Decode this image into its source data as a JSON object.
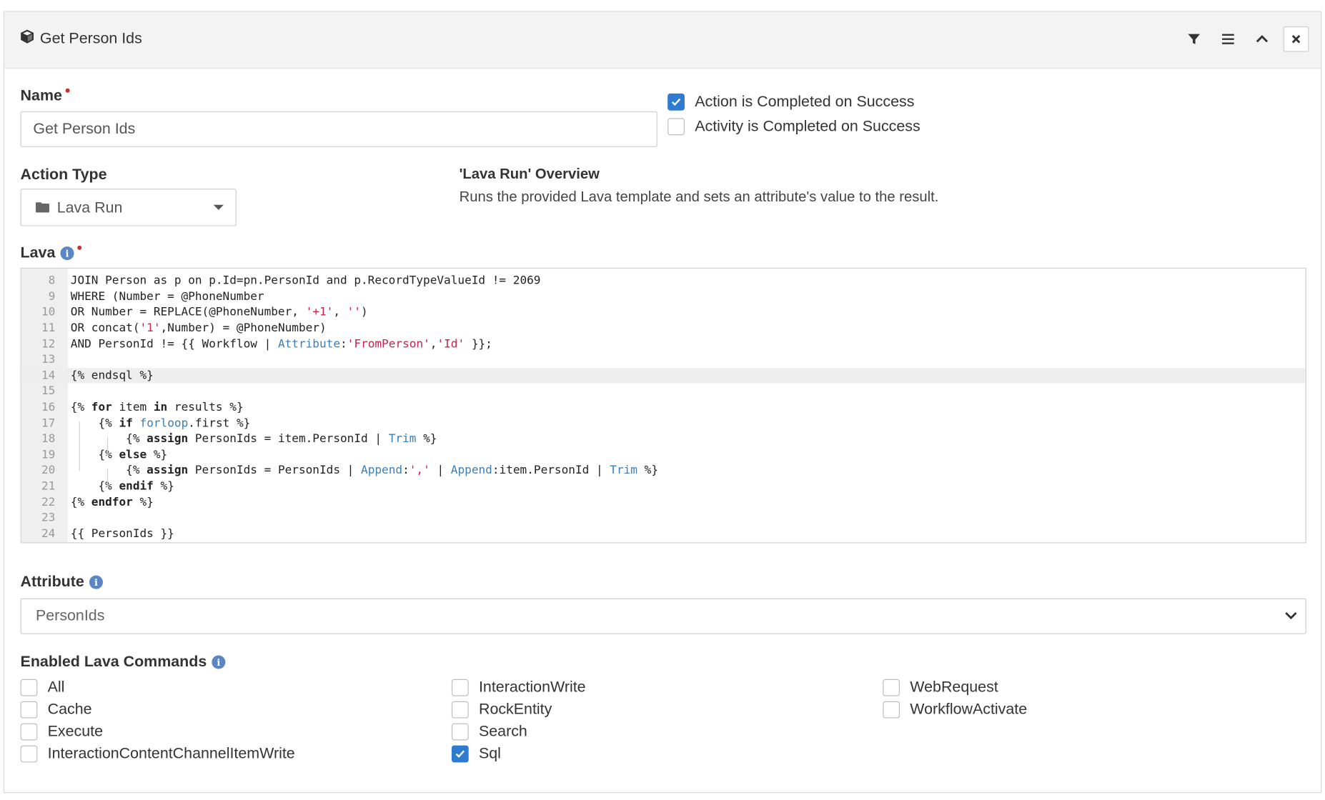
{
  "panel": {
    "title": "Get Person Ids",
    "header_icons": [
      "filter-icon",
      "menu-icon",
      "chevron-up-icon",
      "close-icon"
    ]
  },
  "name": {
    "label": "Name",
    "value": "Get Person Ids"
  },
  "completion": {
    "action_completed_label": "Action is Completed on Success",
    "action_completed_checked": true,
    "activity_completed_label": "Activity is Completed on Success",
    "activity_completed_checked": false
  },
  "action_type": {
    "label": "Action Type",
    "value": "Lava Run",
    "icon": "folder-icon"
  },
  "overview": {
    "title": "'Lava Run' Overview",
    "description": "Runs the provided Lava template and sets an attribute's value to the result."
  },
  "lava": {
    "label": "Lava",
    "active_line": 14,
    "lines": [
      {
        "n": "8",
        "text": "JOIN Person as p on p.Id=pn.PersonId and p.RecordTypeValueId != 2069"
      },
      {
        "n": "9",
        "text": "WHERE (Number = @PhoneNumber"
      },
      {
        "n": "10",
        "text": "OR Number = REPLACE(@PhoneNumber, '+1', '')"
      },
      {
        "n": "11",
        "text": "OR concat('1',Number) = @PhoneNumber)"
      },
      {
        "n": "12",
        "text": "AND PersonId != {{ Workflow | Attribute:'FromPerson','Id' }};"
      },
      {
        "n": "13",
        "text": ""
      },
      {
        "n": "14",
        "text": "{% endsql %}"
      },
      {
        "n": "15",
        "text": ""
      },
      {
        "n": "16",
        "text": "{% for item in results %}"
      },
      {
        "n": "17",
        "text": "    {% if forloop.first %}"
      },
      {
        "n": "18",
        "text": "        {% assign PersonIds = item.PersonId | Trim %}"
      },
      {
        "n": "19",
        "text": "    {% else %}"
      },
      {
        "n": "20",
        "text": "        {% assign PersonIds = PersonIds | Append:',' | Append:item.PersonId | Trim %}"
      },
      {
        "n": "21",
        "text": "    {% endif %}"
      },
      {
        "n": "22",
        "text": "{% endfor %}"
      },
      {
        "n": "23",
        "text": ""
      },
      {
        "n": "24",
        "text": "{{ PersonIds }}"
      }
    ]
  },
  "attribute": {
    "label": "Attribute",
    "value": "PersonIds"
  },
  "lava_commands": {
    "label": "Enabled Lava Commands",
    "columns": [
      [
        {
          "label": "All",
          "checked": false
        },
        {
          "label": "Cache",
          "checked": false
        },
        {
          "label": "Execute",
          "checked": false
        },
        {
          "label": "InteractionContentChannelItemWrite",
          "checked": false
        }
      ],
      [
        {
          "label": "InteractionWrite",
          "checked": false
        },
        {
          "label": "RockEntity",
          "checked": false
        },
        {
          "label": "Search",
          "checked": false
        },
        {
          "label": "Sql",
          "checked": true
        }
      ],
      [
        {
          "label": "WebRequest",
          "checked": false
        },
        {
          "label": "WorkflowActivate",
          "checked": false
        }
      ]
    ]
  },
  "colors": {
    "accent": "#2e7bcf",
    "required": "#c9302c",
    "info": "#5a86c5",
    "code_function": "#3c7db6",
    "code_string": "#c7254e"
  }
}
